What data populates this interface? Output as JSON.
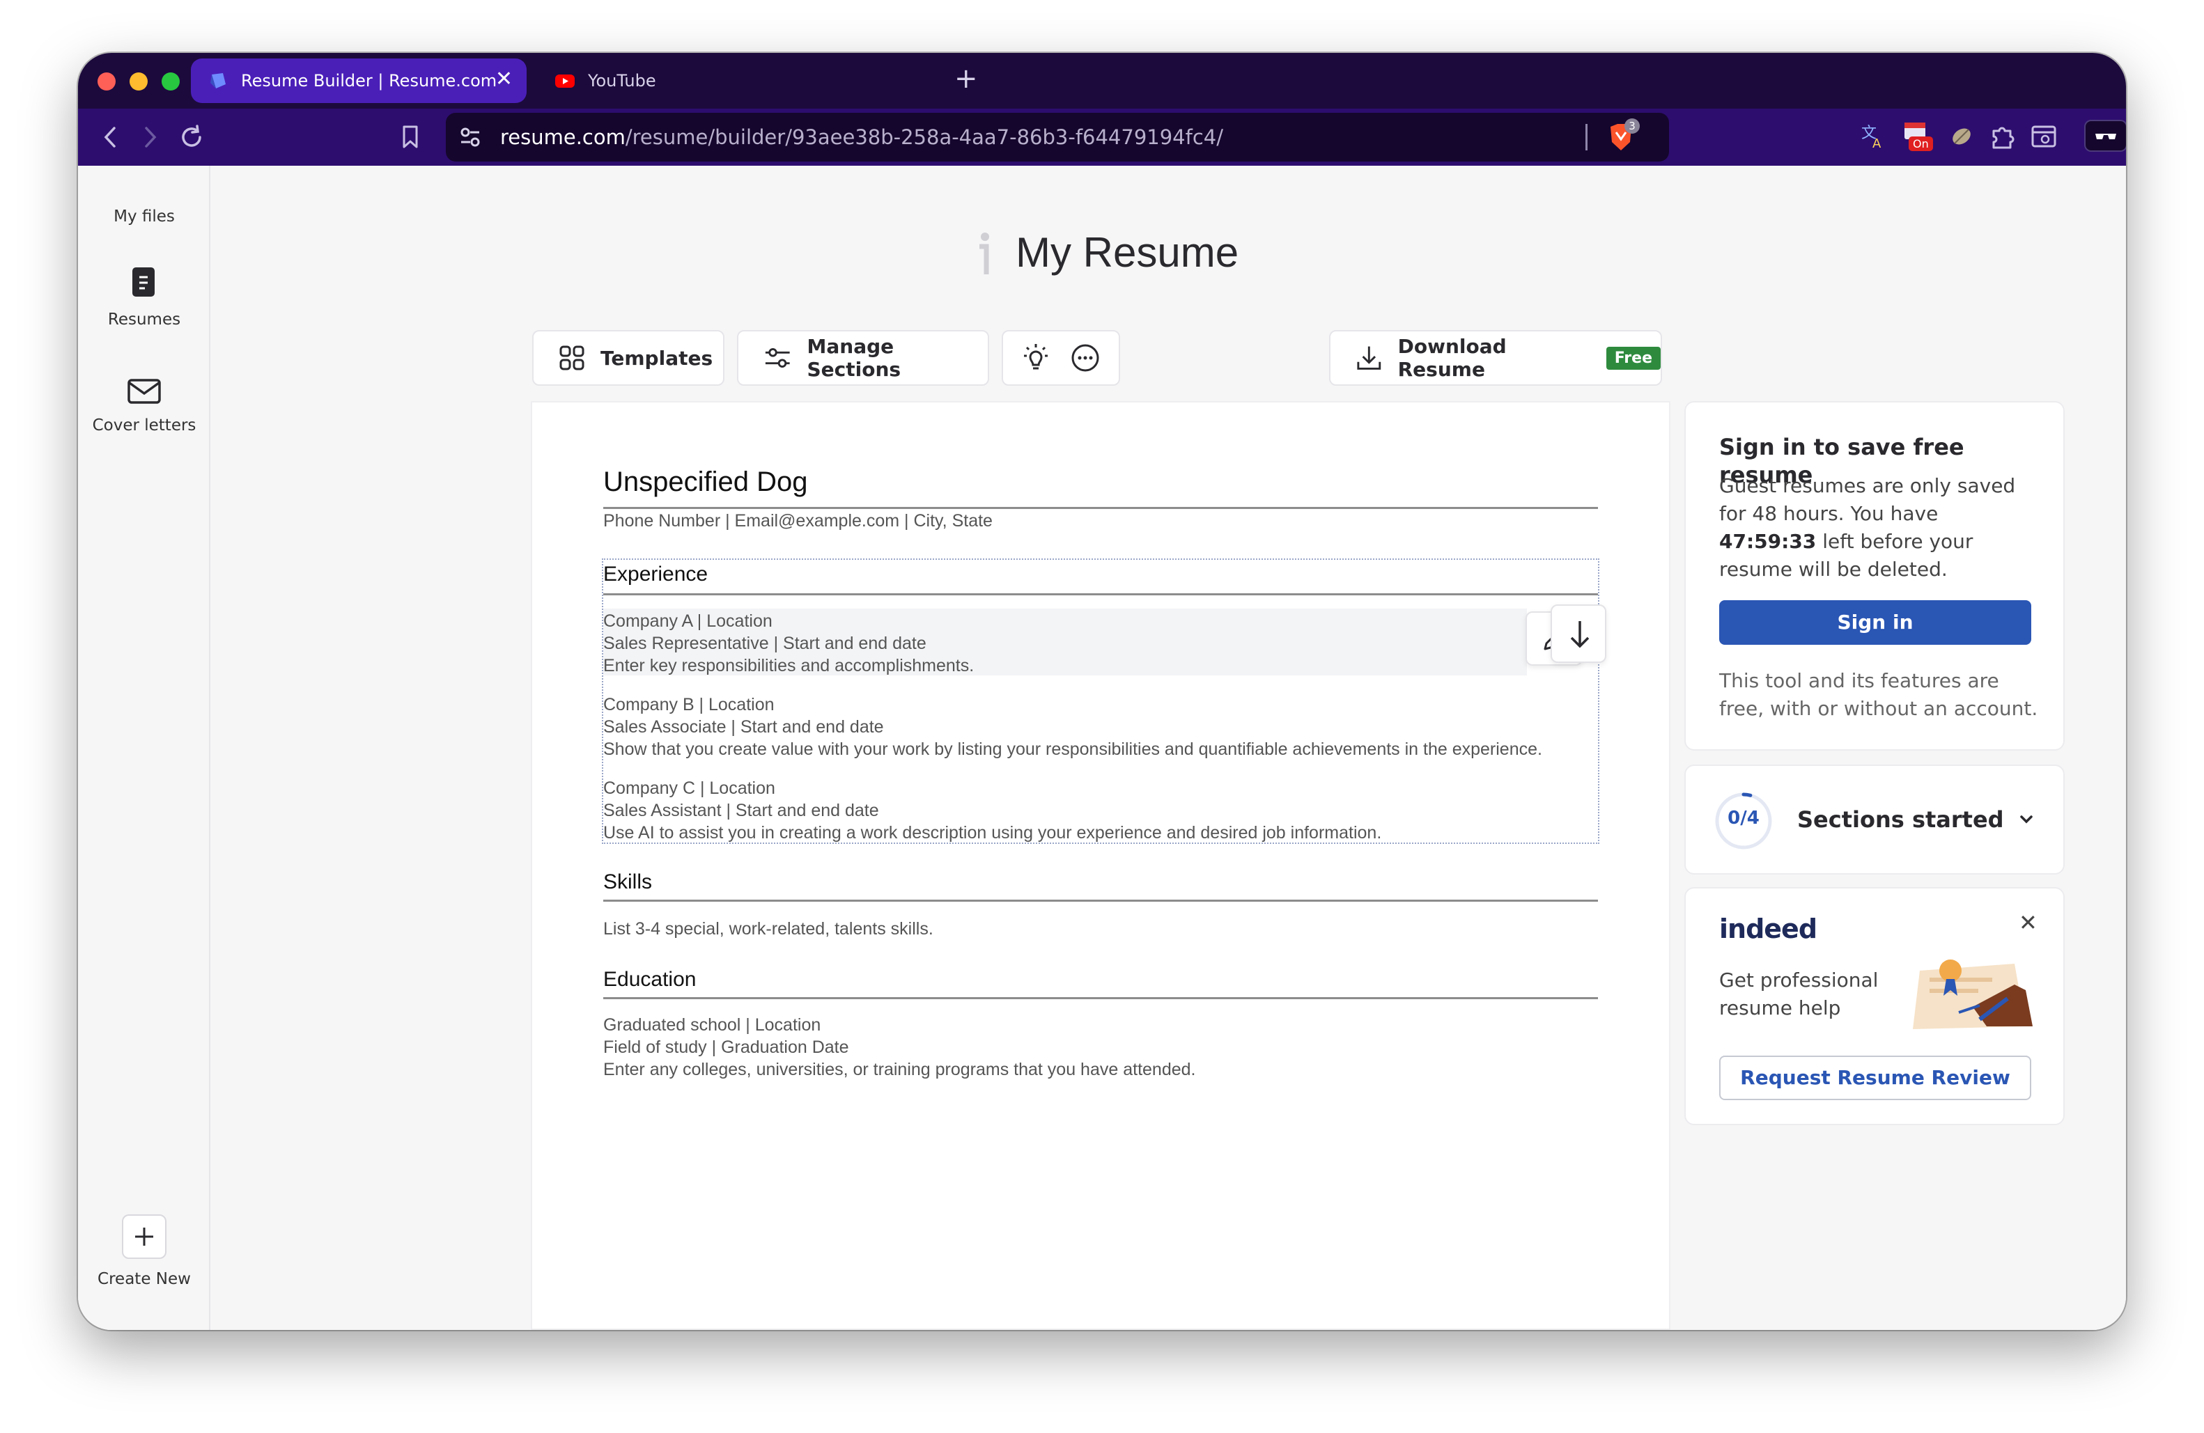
{
  "browser": {
    "tabs": [
      {
        "title": "Resume Builder | Resume.com",
        "active": true
      },
      {
        "title": "YouTube",
        "active": false
      }
    ],
    "close_glyph": "✕",
    "new_tab_glyph": "+",
    "url_domain": "resume.com",
    "url_path": "/resume/builder/93aee38b-258a-4aa7-86b3-f64479194fc4/",
    "brave_badge": "3",
    "ext_badge": "On"
  },
  "sidebar": {
    "my_files": "My files",
    "resumes": "Resumes",
    "cover_letters": "Cover letters",
    "create_new": "Create New"
  },
  "header": {
    "title": "My Resume"
  },
  "toolbar": {
    "templates": "Templates",
    "manage_sections": "Manage Sections",
    "download": "Download Resume",
    "free_badge": "Free"
  },
  "resume": {
    "name": "Unspecified Dog",
    "contact": "Phone Number | Email@example.com | City, State",
    "experience_heading": "Experience",
    "experience": [
      {
        "company": "Company A | Location",
        "role": "Sales Representative | Start and end date",
        "desc": "Enter key responsibilities and accomplishments."
      },
      {
        "company": "Company B | Location",
        "role": "Sales Associate | Start and end date",
        "desc": "Show that you create value with your work by listing your responsibilities and quantifiable achievements in the experience."
      },
      {
        "company": "Company C | Location",
        "role": "Sales Assistant | Start and end date",
        "desc": "Use AI to assist you in creating a work description using your experience and desired job information."
      }
    ],
    "skills_heading": "Skills",
    "skills_text": "List 3-4 special, work-related, talents skills.",
    "education_heading": "Education",
    "education": {
      "school": "Graduated school | Location",
      "field": "Field of study | Graduation Date",
      "desc": "Enter any colleges, universities, or training programs that you have attended."
    }
  },
  "signin_panel": {
    "title": "Sign in to save free resume",
    "body_prefix": "Guest resumes are only saved for 48 hours. You have",
    "timer": "47:59:33",
    "body_suffix": "left before your resume will be deleted.",
    "button": "Sign in",
    "note": "This tool and its features are free, with or without an account."
  },
  "progress_panel": {
    "counter": "0/4",
    "label": "Sections started",
    "fraction": 0.0
  },
  "indeed_panel": {
    "logo": "indeed",
    "text": "Get professional resume help",
    "button": "Request Resume Review",
    "close_glyph": "✕"
  },
  "colors": {
    "tabbar": "#1c0a3c",
    "navbar": "#2d0d6e",
    "active_tab": "#4a1fb8",
    "signin_button": "#2a56b4",
    "free_badge": "#2e8b3e",
    "indeed_blue": "#2a56b4"
  }
}
